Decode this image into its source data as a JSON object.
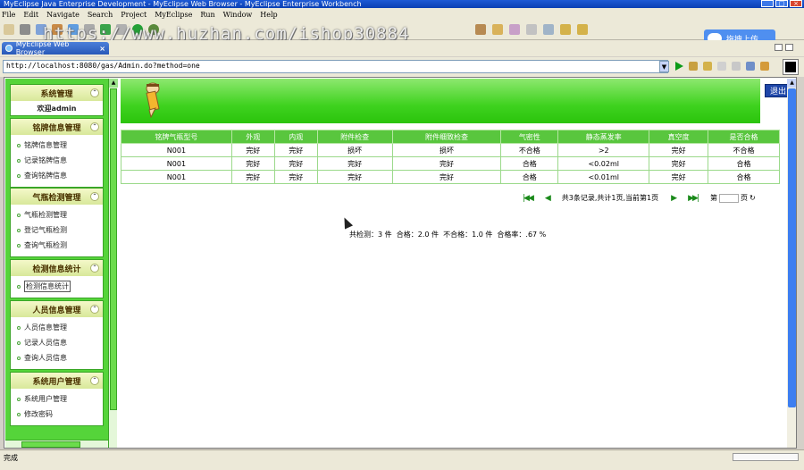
{
  "window": {
    "title": "MyEclipse Java Enterprise Development - MyEclipse Web Browser - MyEclipse Enterprise Workbench"
  },
  "menu": [
    "File",
    "Edit",
    "Navigate",
    "Search",
    "Project",
    "MyEclipse",
    "Run",
    "Window",
    "Help"
  ],
  "watermark": "https://www.huzhan.com/ishop30884",
  "upload_button": "拖拽上传",
  "editor_tab": {
    "label": "MyEclipse Web Browser",
    "close": "×"
  },
  "address": {
    "url": "http://localhost:8080/gas/Admin.do?method=one"
  },
  "sidebar": {
    "system": {
      "title": "系统管理",
      "welcome": "欢迎admin"
    },
    "sections": [
      {
        "title": "铭牌信息管理",
        "items": [
          "铭牌信息管理",
          "记录铭牌信息",
          "查询铭牌信息"
        ]
      },
      {
        "title": "气瓶检测管理",
        "items": [
          "气瓶检测管理",
          "登记气瓶检测",
          "查询气瓶检测"
        ]
      },
      {
        "title": "检测信息统计",
        "items": [
          "检测信息统计"
        ]
      },
      {
        "title": "人员信息管理",
        "items": [
          "人员信息管理",
          "记录人员信息",
          "查询人员信息"
        ]
      },
      {
        "title": "系统用户管理",
        "items": [
          "系统用户管理",
          "修改密码"
        ]
      }
    ]
  },
  "header": {
    "exit_label": "退出"
  },
  "table": {
    "columns": [
      "铭牌气瓶型号",
      "外观",
      "内观",
      "附件检查",
      "附件细致检查",
      "气密性",
      "静态蒸发率",
      "真空度",
      "是否合格"
    ],
    "rows": [
      [
        "N001",
        "完好",
        "完好",
        "损坏",
        "损坏",
        "不合格",
        ">2",
        "完好",
        "不合格"
      ],
      [
        "N001",
        "完好",
        "完好",
        "完好",
        "完好",
        "合格",
        "<0.02ml",
        "完好",
        "合格"
      ],
      [
        "N001",
        "完好",
        "完好",
        "完好",
        "完好",
        "合格",
        "<0.01ml",
        "完好",
        "合格"
      ]
    ]
  },
  "pager": {
    "info": "共3条记录,共计1页,当前第1页",
    "jump_prefix": "第",
    "jump_suffix": "页"
  },
  "summary": "共检测：3 件  合格：2.0 件  不合格：1.0 件  合格率：.67 %",
  "status": {
    "text": "完成"
  },
  "colors": {
    "sidebar_green": "#55d43a",
    "header_green": "#59c63e",
    "exit_blue": "#1e46a8"
  }
}
